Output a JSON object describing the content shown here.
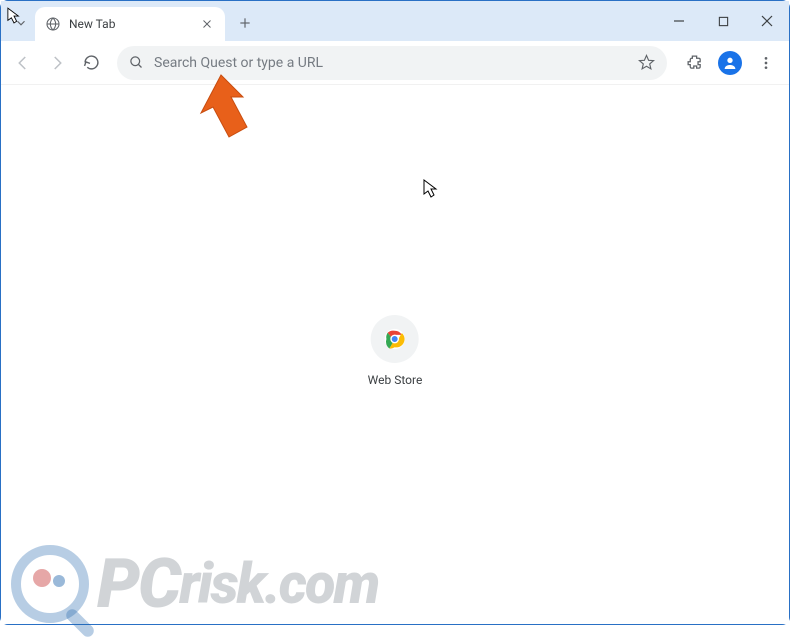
{
  "tab": {
    "title": "New Tab"
  },
  "omnibox": {
    "placeholder": "Search Quest or type a URL"
  },
  "shortcuts": [
    {
      "label": "Web Store"
    }
  ],
  "watermark": {
    "prefix": "PC",
    "suffix": "risk.com"
  }
}
